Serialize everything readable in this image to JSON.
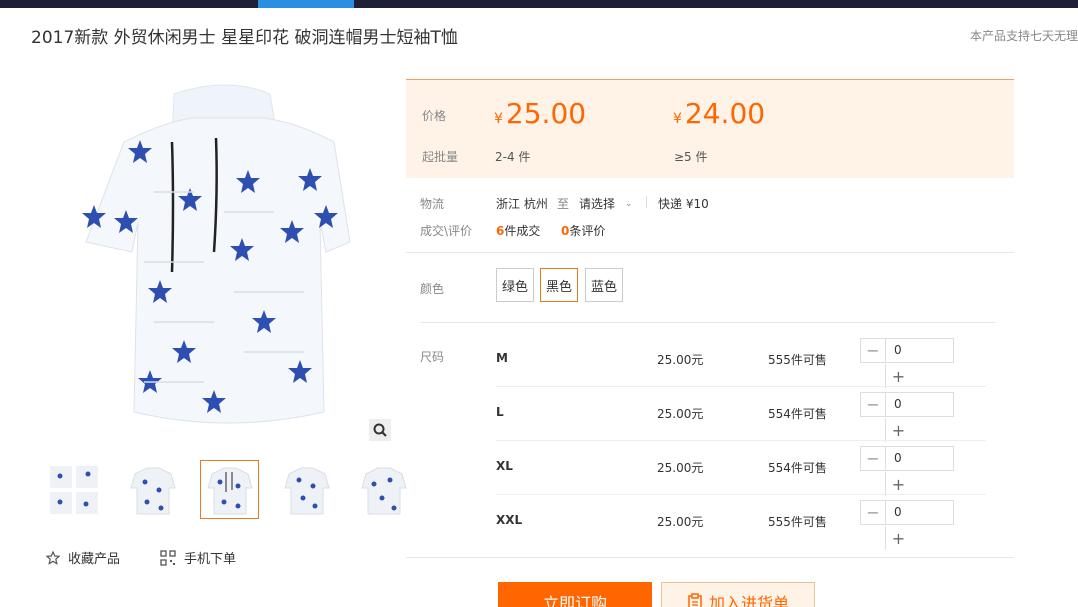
{
  "product": {
    "title": "2017新款 外贸休闲男士 星星印花 破洞连帽男士短袖T恤",
    "support_note": "本产品支持七天无理"
  },
  "prices": {
    "label": "价格",
    "moq_label": "起批量",
    "currency": "¥",
    "tiers": [
      {
        "price": "25.00",
        "moq": "2-4 件"
      },
      {
        "price": "24.00",
        "moq": "≥5 件"
      }
    ]
  },
  "logistics": {
    "label": "物流",
    "from": "浙江 杭州",
    "to_word": "至",
    "select": "请选择",
    "shipping": "快递 ¥10"
  },
  "deals": {
    "label": "成交\\评价",
    "orders_count": "6",
    "orders_text": "件成交",
    "reviews_count": "0",
    "reviews_text": "条评价"
  },
  "colors": {
    "label": "颜色",
    "options": [
      "绿色",
      "黑色",
      "蓝色"
    ],
    "selected": "黑色"
  },
  "sizes": {
    "label": "尺码",
    "rows": [
      {
        "name": "M",
        "price": "25.00元",
        "stock": "555件可售",
        "qty": "0"
      },
      {
        "name": "L",
        "price": "25.00元",
        "stock": "554件可售",
        "qty": "0"
      },
      {
        "name": "XL",
        "price": "25.00元",
        "stock": "554件可售",
        "qty": "0"
      },
      {
        "name": "XXL",
        "price": "25.00元",
        "stock": "555件可售",
        "qty": "0"
      }
    ]
  },
  "actions": {
    "favorite": "收藏产品",
    "mobile_order": "手机下单",
    "buy_now": "立即订购",
    "add_to_list": "加入进货单"
  },
  "colors_theme": {
    "accent": "#ff6600",
    "nav_dark": "#1f1f38",
    "nav_active": "#2a8fe0",
    "star_blue": "#2f4fb0"
  }
}
